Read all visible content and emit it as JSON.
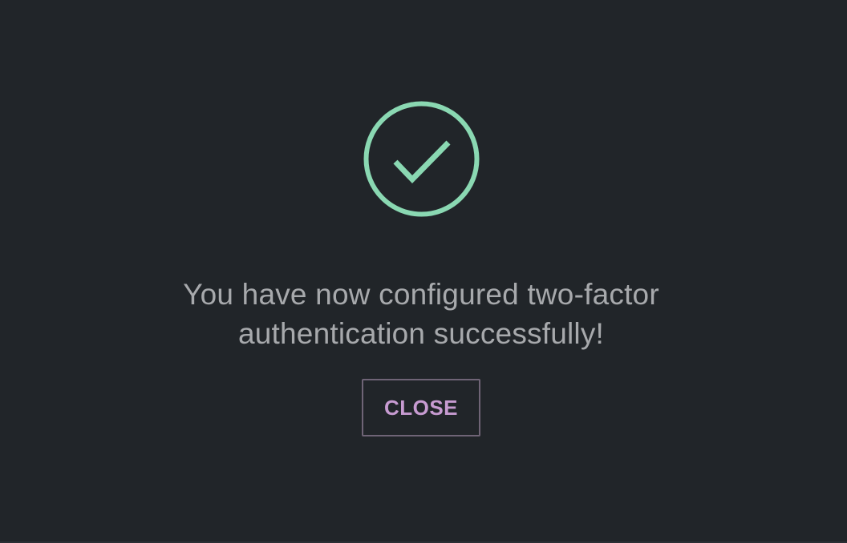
{
  "dialog": {
    "icon": "check-circle-icon",
    "message": "You have now configured two-factor authentication successfully!",
    "close_label": "CLOSE"
  },
  "colors": {
    "background": "#212529",
    "success": "#8ad8b2",
    "text": "#a7a9ac",
    "button_text": "#c79bd1",
    "button_border": "#6f6476"
  }
}
